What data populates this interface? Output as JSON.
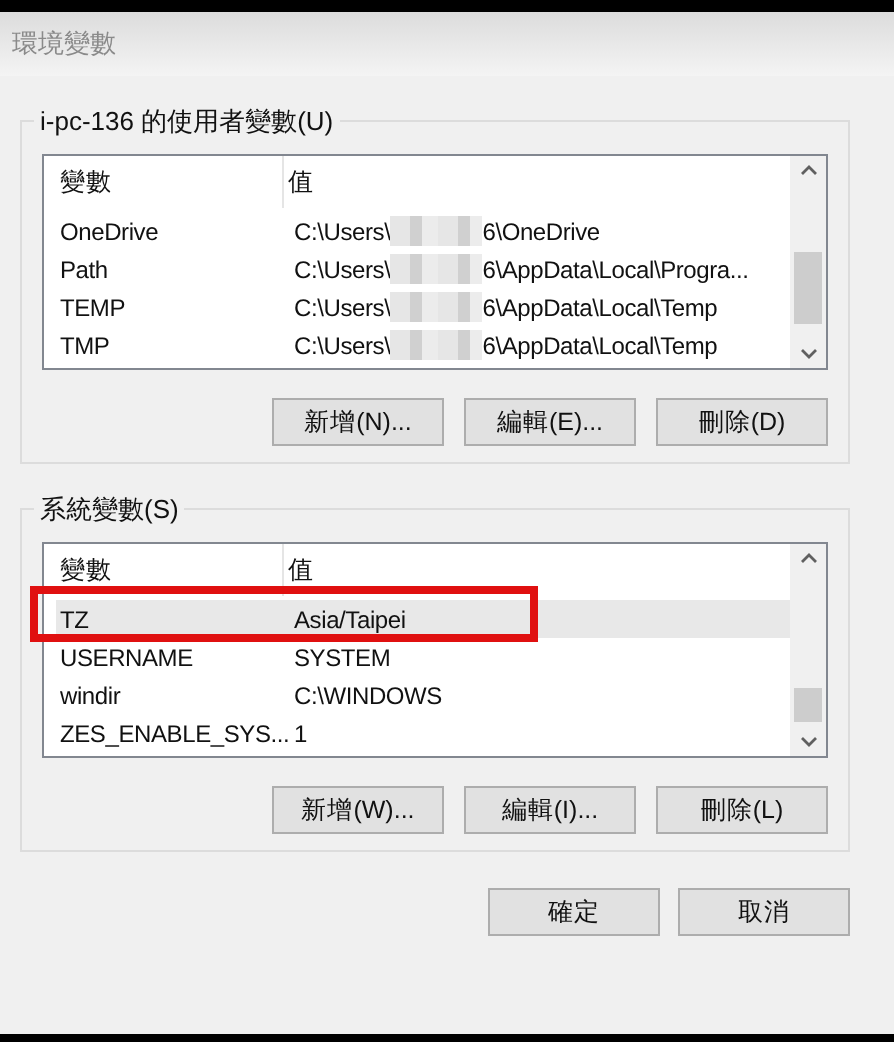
{
  "window": {
    "title": "環境變數"
  },
  "user_variables": {
    "label": "i-pc-136 的使用者變數(U)",
    "columns": [
      "變數",
      "值"
    ],
    "rows": [
      {
        "name": "OneDrive",
        "value_start": "C:\\Users\\",
        "value_end": "6\\OneDrive",
        "redacted": true,
        "selected": false
      },
      {
        "name": "Path",
        "value_start": "C:\\Users\\",
        "value_end": "6\\AppData\\Local\\Progra...",
        "redacted": true,
        "selected": false
      },
      {
        "name": "TEMP",
        "value_start": "C:\\Users\\",
        "value_end": "6\\AppData\\Local\\Temp",
        "redacted": true,
        "selected": false
      },
      {
        "name": "TMP",
        "value_start": "C:\\Users\\",
        "value_end": "6\\AppData\\Local\\Temp",
        "redacted": true,
        "selected": false
      }
    ],
    "buttons": [
      "新增(N)...",
      "編輯(E)...",
      "刪除(D)"
    ]
  },
  "system_variables": {
    "label": "系統變數(S)",
    "columns": [
      "變數",
      "值"
    ],
    "highlighted": true,
    "rows": [
      {
        "name": "TZ",
        "value_start": "Asia/Taipei",
        "selected": true
      },
      {
        "name": "USERNAME",
        "value_start": "SYSTEM",
        "selected": false
      },
      {
        "name": "windir",
        "value_start": "C:\\WINDOWS",
        "selected": false
      },
      {
        "name": "ZES_ENABLE_SYS...",
        "value_start": "1",
        "selected": false
      }
    ],
    "buttons": [
      "新增(W)...",
      "編輯(I)...",
      "刪除(L)"
    ]
  },
  "dialog_buttons": [
    "確定",
    "取消"
  ]
}
